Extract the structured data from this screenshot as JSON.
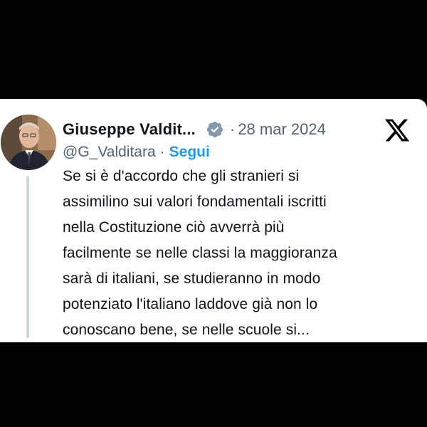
{
  "tweet": {
    "author": {
      "display_name": "Giuseppe Valdit...",
      "handle": "@G_Valditara",
      "verified_icon": "verified-badge-icon",
      "avatar": "profile-photo"
    },
    "separator": "·",
    "date": "28 mar 2024",
    "follow_label": "Segui",
    "platform_icon": "x-logo-icon",
    "text": "Se si è d'accordo che gli stranieri si\nassimilino sui valori fondamentali iscritti\nnella Costituzione ciò avverrà più\nfacilmente se nelle classi la maggioranza\nsarà di italiani, se studieranno in modo\npotenziato l'italiano laddove già non lo\nconoscano bene, se nelle scuole si..."
  },
  "colors": {
    "background": "#000000",
    "card": "#ffffff",
    "text": "#0f1419",
    "secondary": "#536471",
    "link": "#1d9bf0",
    "thread_line": "#cfd9de",
    "verified_badge": "#829aab"
  }
}
